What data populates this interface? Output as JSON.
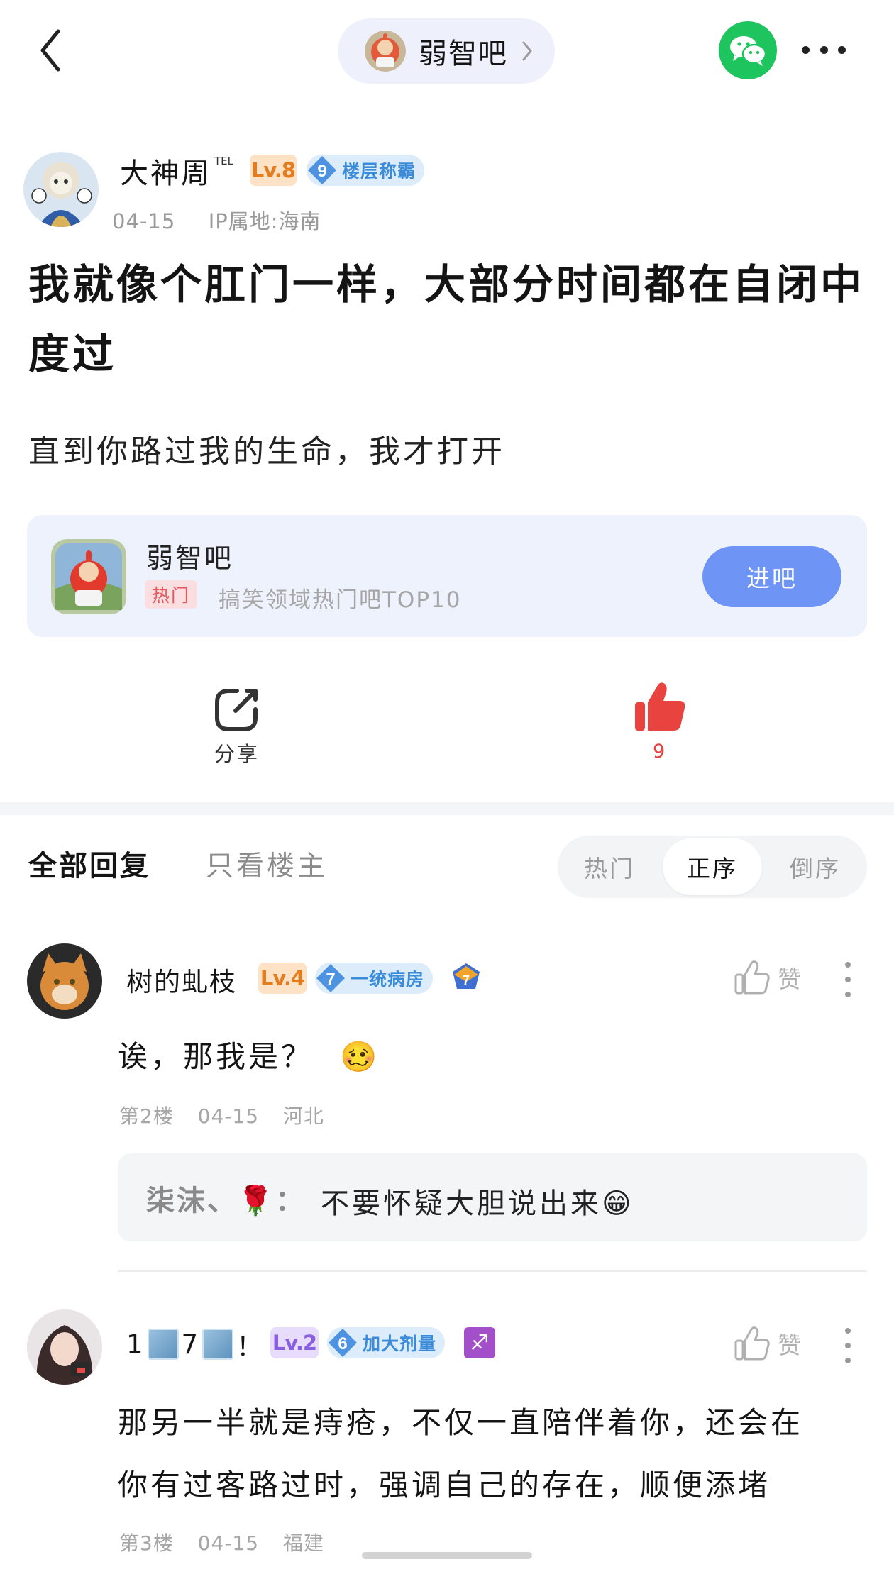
{
  "nav": {
    "forum_name": "弱智吧"
  },
  "post": {
    "author": "大神周",
    "author_tag": "TEL",
    "level": "Lv.8",
    "rank_number": "9",
    "rank_title": "楼层称霸",
    "date": "04-15",
    "ip_location": "IP属地:海南",
    "title": "我就像个肛门一样，大部分时间都在自闭中度过",
    "body": "直到你路过我的生命，我才打开"
  },
  "forum_card": {
    "name": "弱智吧",
    "tag": "热门",
    "description": "搞笑领域热门吧TOP10",
    "join_label": "进吧"
  },
  "actions": {
    "share_label": "分享",
    "like_count": "9"
  },
  "reply_tabs": {
    "all": "全部回复",
    "op_only": "只看楼主",
    "sort_options": [
      "热门",
      "正序",
      "倒序"
    ],
    "sort_selected": "正序"
  },
  "comments": [
    {
      "username": "树的虬枝",
      "level": "Lv.4",
      "rank_number": "7",
      "rank_title": "一统病房",
      "badge_number": "7",
      "like_label": "赞",
      "text": "诶，那我是？",
      "emoji": "🥴",
      "floor": "第2楼",
      "date": "04-15",
      "location": "河北",
      "reply": {
        "user": "柒沫、",
        "user_emoji": "🌹",
        "separator": "：",
        "text": "不要怀疑大胆说出来",
        "emoji": "😁"
      }
    },
    {
      "username_parts": [
        "1",
        "7",
        "！"
      ],
      "level": "Lv.2",
      "rank_number": "6",
      "rank_title": "加大剂量",
      "badge_symbol": "♐",
      "like_label": "赞",
      "text_lines": [
        "那另一半就是痔疮，不仅一直陪伴着你，还会在",
        "你有过客路过时，强调自己的存在，顺便添堵"
      ],
      "floor": "第3楼",
      "date": "04-15",
      "location": "福建"
    }
  ],
  "colors": {
    "accent_blue": "#6e95f5",
    "like_red": "#e8433e",
    "wechat_green": "#1ec45e"
  }
}
